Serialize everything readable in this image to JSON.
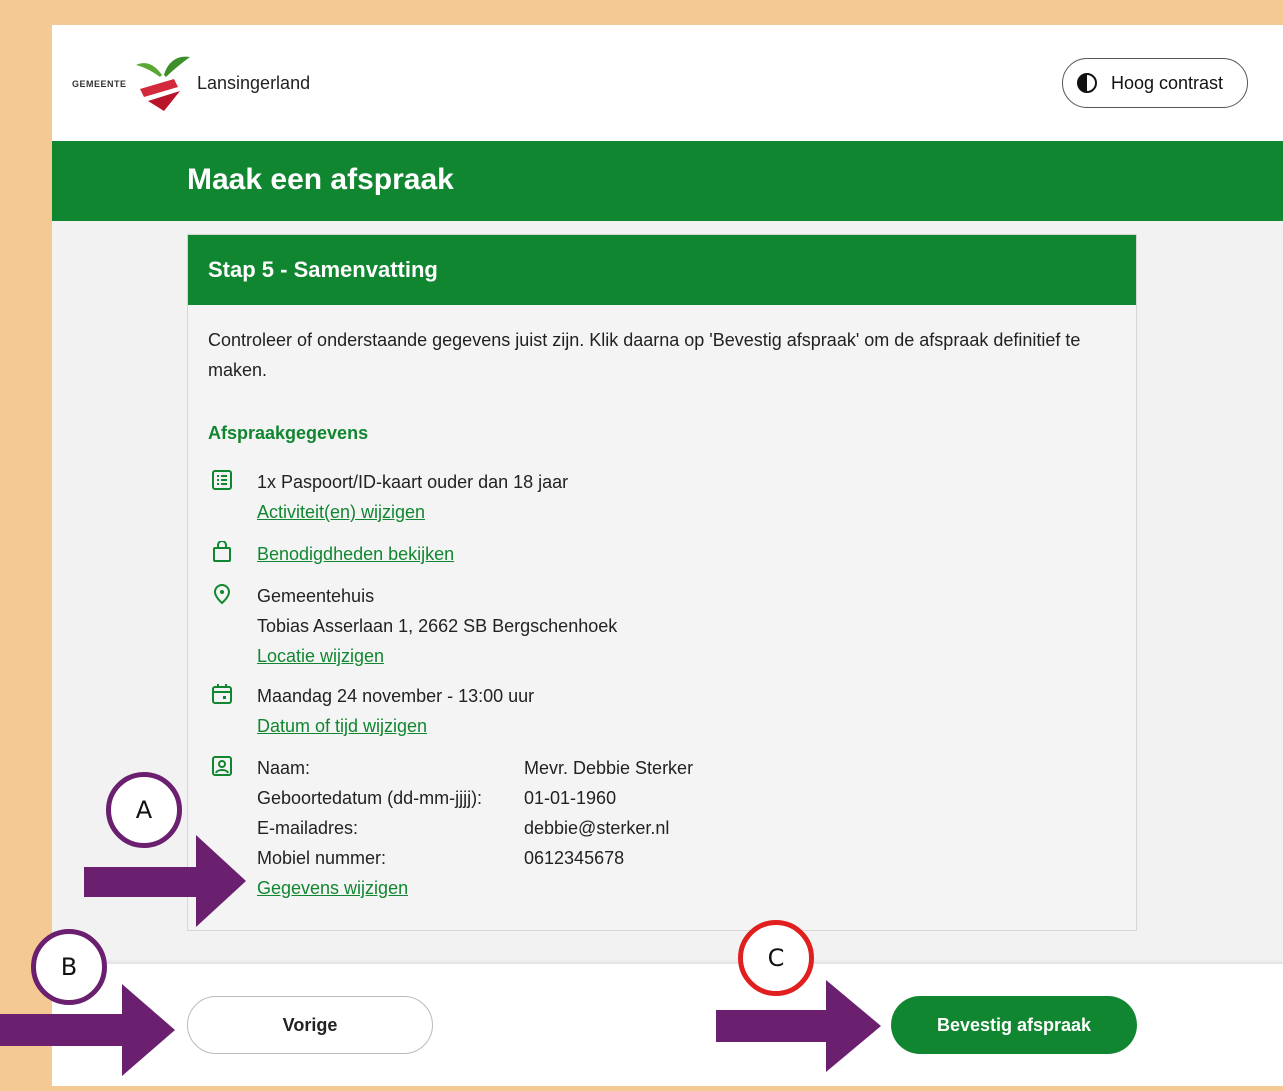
{
  "header": {
    "logo_prefix": "GEMEENTE",
    "logo_name": "Lansingerland",
    "contrast_label": "Hoog contrast"
  },
  "page_title": "Maak een afspraak",
  "card": {
    "heading": "Stap 5 - Samenvatting",
    "intro": "Controleer of onderstaande gegevens juist zijn. Klik daarna op 'Bevestig afspraak' om de afspraak definitief te maken.",
    "section_heading": "Afspraakgegevens",
    "activity": {
      "icon": "list-icon",
      "text": "1x Paspoort/ID-kaart ouder dan 18 jaar",
      "link": "Activiteit(en) wijzigen"
    },
    "requirements": {
      "icon": "bag-icon",
      "link": "Benodigdheden bekijken"
    },
    "location": {
      "icon": "location-pin-icon",
      "name": "Gemeentehuis",
      "address": "Tobias Asserlaan 1, 2662 SB Bergschenhoek",
      "link": "Locatie wijzigen"
    },
    "datetime": {
      "icon": "calendar-icon",
      "text": "Maandag 24 november - 13:00 uur",
      "link": "Datum of tijd wijzigen"
    },
    "person": {
      "icon": "person-card-icon",
      "rows": [
        {
          "label": "Naam:",
          "value": "Mevr. Debbie Sterker"
        },
        {
          "label": "Geboortedatum (dd-mm-jjjj):",
          "value": "01-01-1960"
        },
        {
          "label": "E-mailadres:",
          "value": "debbie@sterker.nl"
        },
        {
          "label": "Mobiel nummer:",
          "value": "0612345678"
        }
      ],
      "link": "Gegevens wijzigen"
    }
  },
  "footer": {
    "prev_label": "Vorige",
    "confirm_label": "Bevestig afspraak"
  },
  "annotations": {
    "a": "A",
    "b": "B",
    "c": "C",
    "arrow_color": "#6a1f6f",
    "circle_purple": "#6a1f6f",
    "circle_red": "#e0201e"
  },
  "colors": {
    "brand_green": "#118630",
    "frame": "#f5c994"
  }
}
